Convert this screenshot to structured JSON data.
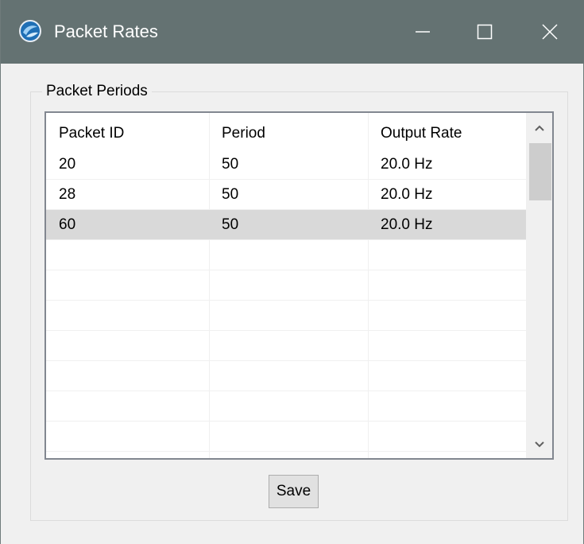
{
  "window": {
    "title": "Packet Rates"
  },
  "group": {
    "label": "Packet Periods"
  },
  "table": {
    "columns": [
      "Packet ID",
      "Period",
      "Output Rate"
    ],
    "rows": [
      [
        "20",
        "50",
        "20.0 Hz"
      ],
      [
        "28",
        "50",
        "20.0 Hz"
      ],
      [
        "60",
        "50",
        "20.0 Hz"
      ]
    ],
    "selected_row": 2
  },
  "buttons": {
    "save_label": "Save"
  },
  "icons": {
    "app": "app-logo-icon",
    "minimize": "minimize-icon",
    "maximize": "maximize-icon",
    "close": "close-icon",
    "scroll_up": "chevron-up-icon",
    "scroll_down": "chevron-down-icon"
  },
  "colors": {
    "titlebar": "#647272",
    "selection": "#d9d9d9",
    "background": "#f0f0f0"
  }
}
